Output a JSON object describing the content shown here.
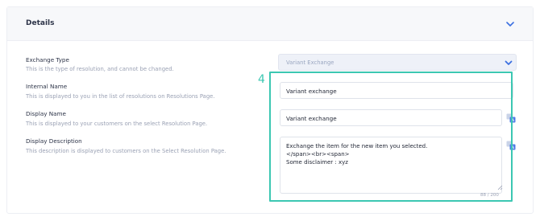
{
  "section": {
    "title": "Details"
  },
  "fields": {
    "exchange_type": {
      "label": "Exchange Type",
      "hint": "This is the type of resolution, and cannot be changed.",
      "value": "Variant Exchange"
    },
    "internal_name": {
      "label": "Internal Name",
      "hint": "This is displayed to you in the list of resolutions on Resolutions Page.",
      "value": "Variant exchange"
    },
    "display_name": {
      "label": "Display Name",
      "hint": "This is displayed to your customers on the select Resolution Page.",
      "value": "Variant exchange"
    },
    "display_description": {
      "label": "Display Description",
      "hint": "This description is displayed to customers on the Select Resolution Page.",
      "lines": [
        "Exchange the item for the new item you selected.",
        "</span><br><span>",
        "Some disclaimer : xyz"
      ],
      "counter": "88 / 200"
    }
  },
  "annotation": {
    "step_number": "4",
    "color": "#3cc7b2"
  },
  "colors": {
    "accent": "#3b6fe0",
    "label": "#2d3448",
    "hint": "#9aa1b4"
  },
  "icons": {
    "collapse": "chevron-down-icon",
    "translate": "translate-icon"
  }
}
